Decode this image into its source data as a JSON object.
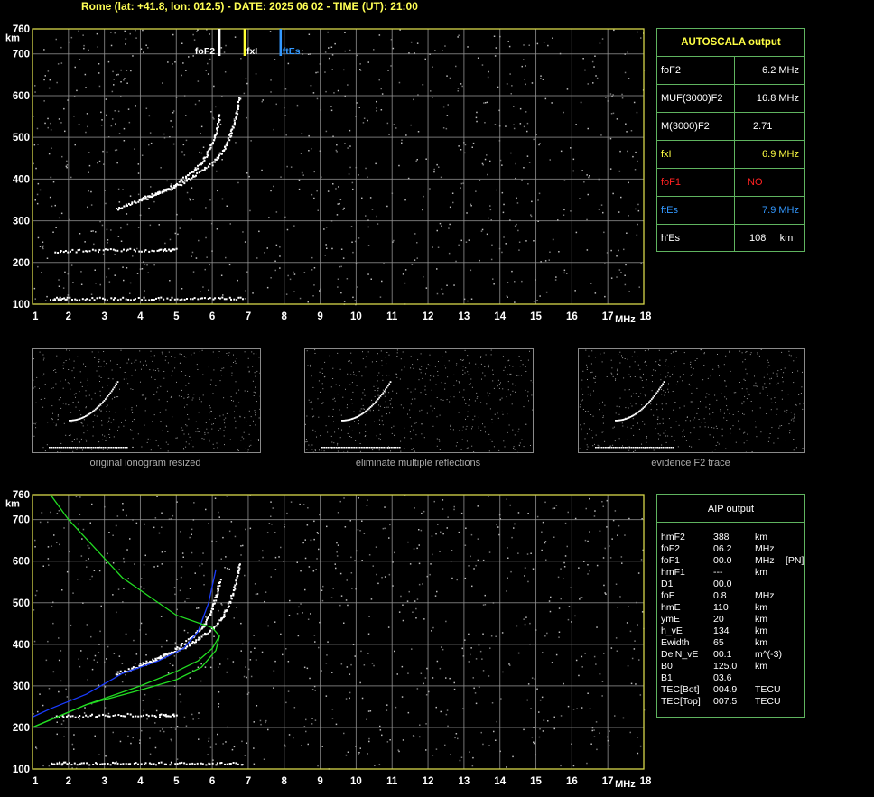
{
  "header": {
    "title": "Rome (lat: +41.8, lon: 012.5) - DATE: 2025 06 02 - TIME (UT): 21:00"
  },
  "top_ionogram": {
    "y_unit": "km",
    "x_unit": "MHz",
    "y_ticks": [
      "100",
      "200",
      "300",
      "400",
      "500",
      "600",
      "700",
      "760"
    ],
    "x_ticks": [
      "1",
      "2",
      "3",
      "4",
      "5",
      "6",
      "7",
      "8",
      "9",
      "10",
      "11",
      "12",
      "13",
      "14",
      "15",
      "16",
      "17",
      "18"
    ],
    "markers": [
      {
        "label": "foF2",
        "freq": 6.2,
        "color": "#ffffff"
      },
      {
        "label": "fxI",
        "freq": 6.9,
        "color": "#ffff33"
      },
      {
        "label": "ftEs",
        "freq": 7.9,
        "color": "#3399ff"
      }
    ]
  },
  "bottom_ionogram": {
    "y_unit": "km",
    "x_unit": "MHz",
    "y_ticks": [
      "100",
      "200",
      "300",
      "400",
      "500",
      "600",
      "700",
      "760"
    ],
    "x_ticks": [
      "1",
      "2",
      "3",
      "4",
      "5",
      "6",
      "7",
      "8",
      "9",
      "10",
      "11",
      "12",
      "13",
      "14",
      "15",
      "16",
      "17",
      "18"
    ]
  },
  "thumbnails": [
    {
      "caption": "original ionogram resized"
    },
    {
      "caption": "eliminate multiple reflections"
    },
    {
      "caption": "evidence F2 trace"
    }
  ],
  "autoscala": {
    "title": "AUTOSCALA output",
    "rows": [
      {
        "label": "foF2",
        "value": "6.2 MHz",
        "label_color": "#ffffff",
        "value_color": "#ffffff"
      },
      {
        "label": "MUF(3000)F2",
        "value": "16.8 MHz",
        "label_color": "#ffffff",
        "value_color": "#ffffff"
      },
      {
        "label": "M(3000)F2",
        "value": "2.71",
        "label_color": "#ffffff",
        "value_color": "#ffffff"
      },
      {
        "label": "fxI",
        "value": "6.9 MHz",
        "label_color": "#ffff44",
        "value_color": "#ffff44"
      },
      {
        "label": "foF1",
        "value": "NO",
        "label_color": "#ff2222",
        "value_color": "#ff2222"
      },
      {
        "label": "ftEs",
        "value": "7.9 MHz",
        "label_color": "#3399ff",
        "value_color": "#3399ff"
      },
      {
        "label": "h'Es",
        "value": "108     km",
        "label_color": "#ffffff",
        "value_color": "#ffffff"
      }
    ]
  },
  "aip": {
    "title": "AIP output",
    "rows": [
      {
        "k": "hmF2",
        "v": "388",
        "u": "km",
        "x": ""
      },
      {
        "k": "foF2",
        "v": "06.2",
        "u": "MHz",
        "x": ""
      },
      {
        "k": "foF1",
        "v": "00.0",
        "u": "MHz",
        "x": "[PN]"
      },
      {
        "k": "hmF1",
        "v": "---",
        "u": "km",
        "x": ""
      },
      {
        "k": "D1",
        "v": "00.0",
        "u": "",
        "x": ""
      },
      {
        "k": "foE",
        "v": "0.8",
        "u": "MHz",
        "x": ""
      },
      {
        "k": "hmE",
        "v": "110",
        "u": "km",
        "x": ""
      },
      {
        "k": "ymE",
        "v": "20",
        "u": "km",
        "x": ""
      },
      {
        "k": "h_vE",
        "v": "134",
        "u": "km",
        "x": ""
      },
      {
        "k": "Ewidth",
        "v": "65",
        "u": "km",
        "x": ""
      },
      {
        "k": "DelN_vE",
        "v": "00.1",
        "u": "m^(-3)",
        "x": ""
      },
      {
        "k": "B0",
        "v": "125.0",
        "u": "km",
        "x": ""
      },
      {
        "k": "B1",
        "v": "03.6",
        "u": "",
        "x": ""
      },
      {
        "k": "TEC[Bot]",
        "v": "004.9",
        "u": "TECU",
        "x": ""
      },
      {
        "k": "TEC[Top]",
        "v": "007.5",
        "u": "TECU",
        "x": ""
      }
    ]
  },
  "chart_data": [
    {
      "type": "scatter",
      "xlabel": "MHz",
      "ylabel": "km",
      "xlim": [
        1,
        18
      ],
      "ylim": [
        100,
        760
      ],
      "grid": true,
      "series": [
        {
          "name": "F2 trace (o)",
          "x": [
            3.3,
            3.8,
            4.3,
            4.8,
            5.3,
            5.7,
            5.95,
            6.1,
            6.2
          ],
          "y": [
            330,
            345,
            360,
            380,
            410,
            440,
            480,
            520,
            560
          ],
          "color": "#ffffff"
        },
        {
          "name": "F2 trace (x)",
          "x": [
            4.0,
            4.5,
            5.0,
            5.5,
            6.0,
            6.3,
            6.5,
            6.65,
            6.75
          ],
          "y": [
            355,
            368,
            385,
            410,
            440,
            470,
            510,
            555,
            600
          ],
          "color": "#ffffff"
        },
        {
          "name": "Es trace",
          "x": [
            1.5,
            2,
            3,
            4,
            5,
            6,
            6.9
          ],
          "y": [
            115,
            115,
            115,
            115,
            115,
            115,
            115
          ],
          "color": "#ffffff"
        },
        {
          "name": "multiple Es",
          "x": [
            1.6,
            2.5,
            3.5,
            4.5,
            5
          ],
          "y": [
            228,
            230,
            232,
            230,
            232
          ],
          "color": "#ffffff"
        }
      ]
    },
    {
      "type": "line",
      "xlabel": "MHz",
      "ylabel": "km",
      "xlim": [
        1,
        18
      ],
      "ylim": [
        100,
        760
      ],
      "grid": true,
      "series": [
        {
          "name": "F2 trace",
          "x": [
            1.0,
            1.5,
            2.5,
            3.5,
            4.5,
            5.2,
            5.6,
            5.9,
            6.1
          ],
          "y": [
            225,
            245,
            280,
            330,
            360,
            390,
            430,
            500,
            580
          ],
          "color": "#1a3cff"
        },
        {
          "name": "profile true height",
          "x": [
            1.0,
            2.5,
            4.0,
            5.0,
            5.7,
            6.1,
            6.2,
            6.0,
            5.0,
            3.5,
            2.0,
            1.5
          ],
          "y": [
            200,
            255,
            290,
            315,
            345,
            385,
            420,
            440,
            470,
            560,
            700,
            760
          ],
          "color": "#22dd22"
        },
        {
          "name": "profile virtual",
          "x": [
            1.0,
            2.5,
            4.0,
            5.0,
            5.6,
            6.0,
            6.2
          ],
          "y": [
            200,
            255,
            300,
            335,
            360,
            390,
            420
          ],
          "color": "#22dd22"
        }
      ]
    }
  ]
}
